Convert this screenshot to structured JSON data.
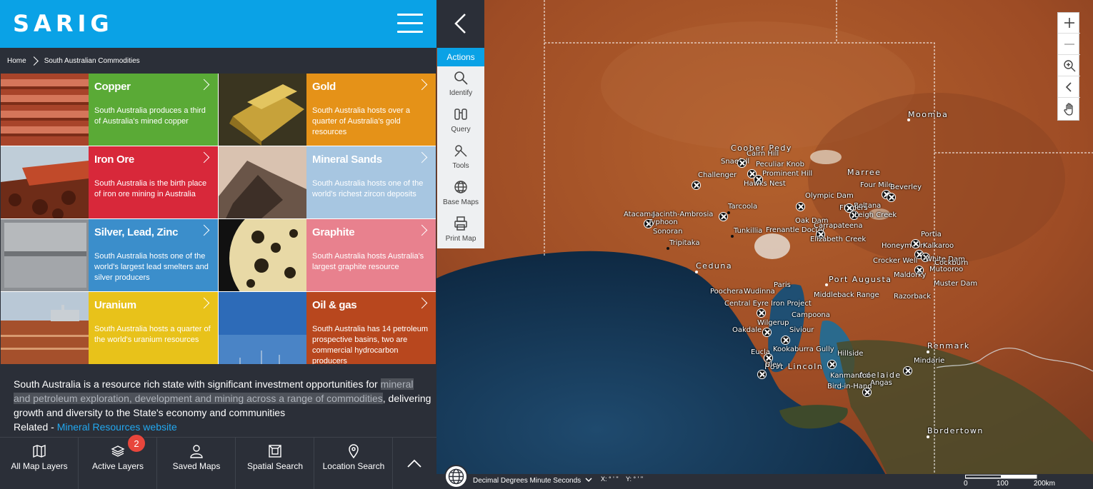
{
  "header": {
    "logo": "SARIG",
    "menu_icon": "hamburger-icon"
  },
  "breadcrumb": {
    "home": "Home",
    "current": "South Australian Commodities"
  },
  "commodities": [
    {
      "title": "Copper",
      "desc": "South Australia produces a third of Australia's mined copper",
      "color": "#5aaa36"
    },
    {
      "title": "Gold",
      "desc": "South Australia hosts over a quarter of Australia's gold resources",
      "color": "#e59218"
    },
    {
      "title": "Iron Ore",
      "desc": "South Australia is the birth place of iron ore mining in Australia",
      "color": "#d8283a"
    },
    {
      "title": "Mineral Sands",
      "desc": "South Australia hosts one of the world's richest zircon deposits",
      "color": "#a7c6e1"
    },
    {
      "title": "Silver, Lead, Zinc",
      "desc": "South Australia hosts one of the world's largest lead smelters and silver producers",
      "color": "#3b8ecb"
    },
    {
      "title": "Graphite",
      "desc": "South Australia hosts Australia's largest graphite resource",
      "color": "#e8818e"
    },
    {
      "title": "Uranium",
      "desc": "South Australia hosts a quarter of the world's uranium resources",
      "color": "#e8c21a"
    },
    {
      "title": "Oil & gas",
      "desc": "South Australia has 14 petroleum prospective basins, two are commercial hydrocarbon producers",
      "color": "#b8471e"
    }
  ],
  "intro": {
    "part1": "South Australia is a resource rich state with significant investment opportunities for ",
    "highlight": "mineral and petroleum exploration, development and mining across a range of commodities",
    "part2": ", delivering growth and diversity to the State's economy and communities",
    "related_label": "Related - ",
    "related_link": "Mineral Resources website"
  },
  "bottom_nav": [
    {
      "label": "All Map Layers",
      "icon": "map-icon"
    },
    {
      "label": "Active Layers",
      "icon": "layers-icon"
    },
    {
      "label": "Saved Maps",
      "icon": "user-icon"
    },
    {
      "label": "Spatial Search",
      "icon": "spatial-search-icon"
    },
    {
      "label": "Location Search",
      "icon": "location-pin-icon"
    }
  ],
  "active_layers_badge": "2",
  "actions": {
    "title": "Actions",
    "items": [
      {
        "label": "Identify",
        "icon": "magnifier-icon"
      },
      {
        "label": "Query",
        "icon": "binoculars-icon"
      },
      {
        "label": "Tools",
        "icon": "tools-icon"
      },
      {
        "label": "Base Maps",
        "icon": "globe-icon"
      },
      {
        "label": "Print Map",
        "icon": "printer-icon"
      }
    ]
  },
  "zoom_controls": [
    "zoom-in-icon",
    "zoom-out-icon",
    "zoom-magnifier-icon",
    "previous-extent-icon",
    "pan-hand-icon"
  ],
  "coord_bar": {
    "projection": "Decimal Degrees Minute Seconds",
    "x": "X: ° ' \"",
    "y": "Y: ° ' \""
  },
  "scale": {
    "labels": [
      "0",
      "100",
      "200km"
    ]
  },
  "map": {
    "towns": [
      "Moomba",
      "Coober Pedy",
      "Marree",
      "Ceduna",
      "Port Augusta",
      "Renmark",
      "Port Lincoln",
      "Adelaide",
      "Bordertown"
    ],
    "sites": [
      "Cairn Hill",
      "Snaefell",
      "Peculiar Knob",
      "Challenger",
      "Prominent Hill",
      "Hawks Nest",
      "Four Mile",
      "Beverley",
      "Olympic Dam",
      "Beltana",
      "Flinders",
      "Leigh Creek",
      "Tarcoola",
      "Atacama",
      "Jacinth-Ambrosia",
      "Typhoon",
      "Sonoran",
      "Tunkillia",
      "Frenantle Doctor",
      "Oak Dam",
      "Carrapateena",
      "Elizabeth Creek",
      "Tripitaka",
      "Portia",
      "Honeymoon",
      "Kalkaroo",
      "Crocker Well",
      "White Dam",
      "Cockburn",
      "Mutooroo",
      "Maldorky",
      "Muster Dam",
      "Poochera",
      "Wudinna",
      "Paris",
      "Middleback Range",
      "Razorback",
      "Central Eyre Iron Project",
      "Campoona",
      "Wilgerup",
      "Oakdale",
      "Siviour",
      "Kookaburra Gully",
      "Hillside",
      "Eucla",
      "Uley",
      "Mindarie",
      "Kanmantoo",
      "Angas",
      "Bird-in-Hand"
    ]
  }
}
